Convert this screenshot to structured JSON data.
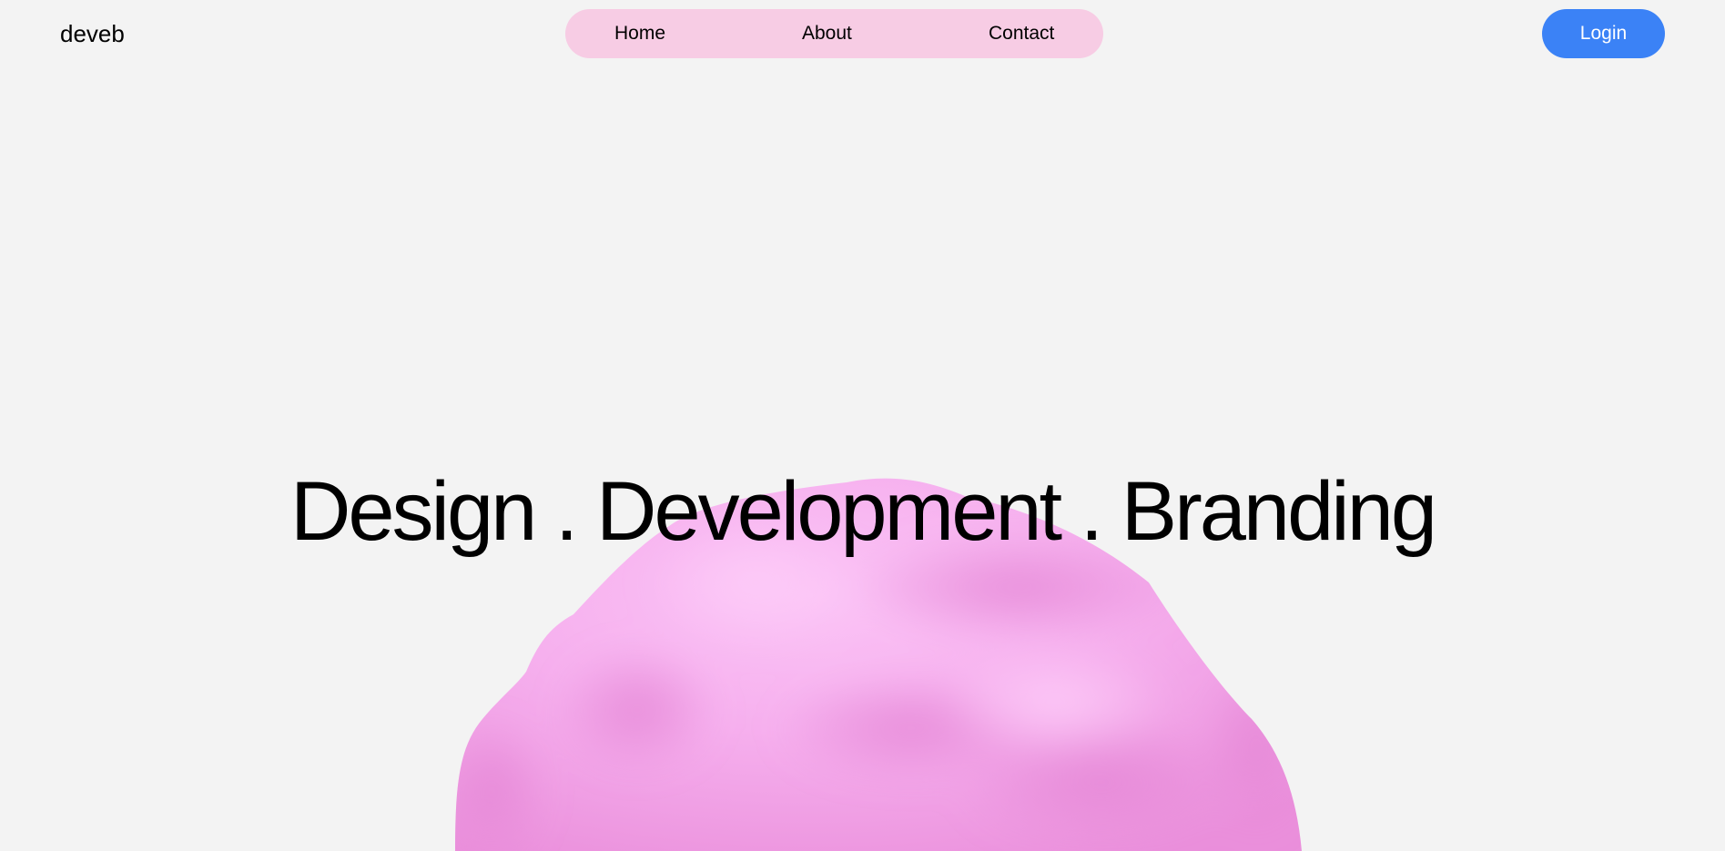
{
  "brand": {
    "logo_text": "deveb"
  },
  "nav": {
    "items": [
      {
        "label": "Home"
      },
      {
        "label": "About"
      },
      {
        "label": "Contact"
      }
    ],
    "pill_color": "#f7cce4"
  },
  "header": {
    "login_label": "Login",
    "login_color": "#3b82f6"
  },
  "hero": {
    "tagline": "Design . Development . Branding",
    "blob_color": "#f4a3ea"
  }
}
